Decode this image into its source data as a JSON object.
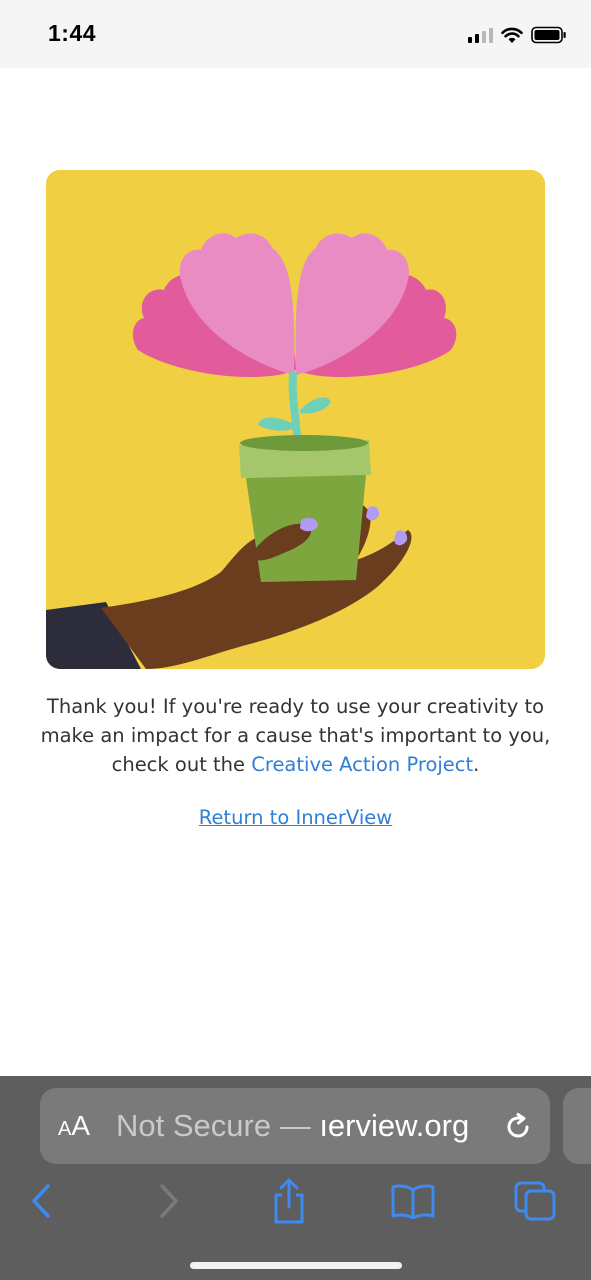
{
  "status_bar": {
    "time": "1:44"
  },
  "content": {
    "message_before_link": "Thank you! If you're ready to use your creativity to make an impact for a cause that's important to you, check out the ",
    "message_link": "Creative Action Project",
    "message_after_link": ".",
    "return_link": "Return to InnerView"
  },
  "browser": {
    "text_size_small": "A",
    "text_size_big": "A",
    "url_prefix": "Not Secure — ",
    "url_domain": "ıerview.org"
  },
  "colors": {
    "illustration_background": "#f0cf42",
    "link": "#2f7fd6",
    "toolbar": "#5e5e5e",
    "toolbar_icons": "#3d8bf0"
  },
  "icons": [
    "signal-icon",
    "wifi-icon",
    "battery-icon",
    "reload-icon",
    "back-icon",
    "forward-icon",
    "share-icon",
    "bookmarks-icon",
    "tabs-icon"
  ]
}
